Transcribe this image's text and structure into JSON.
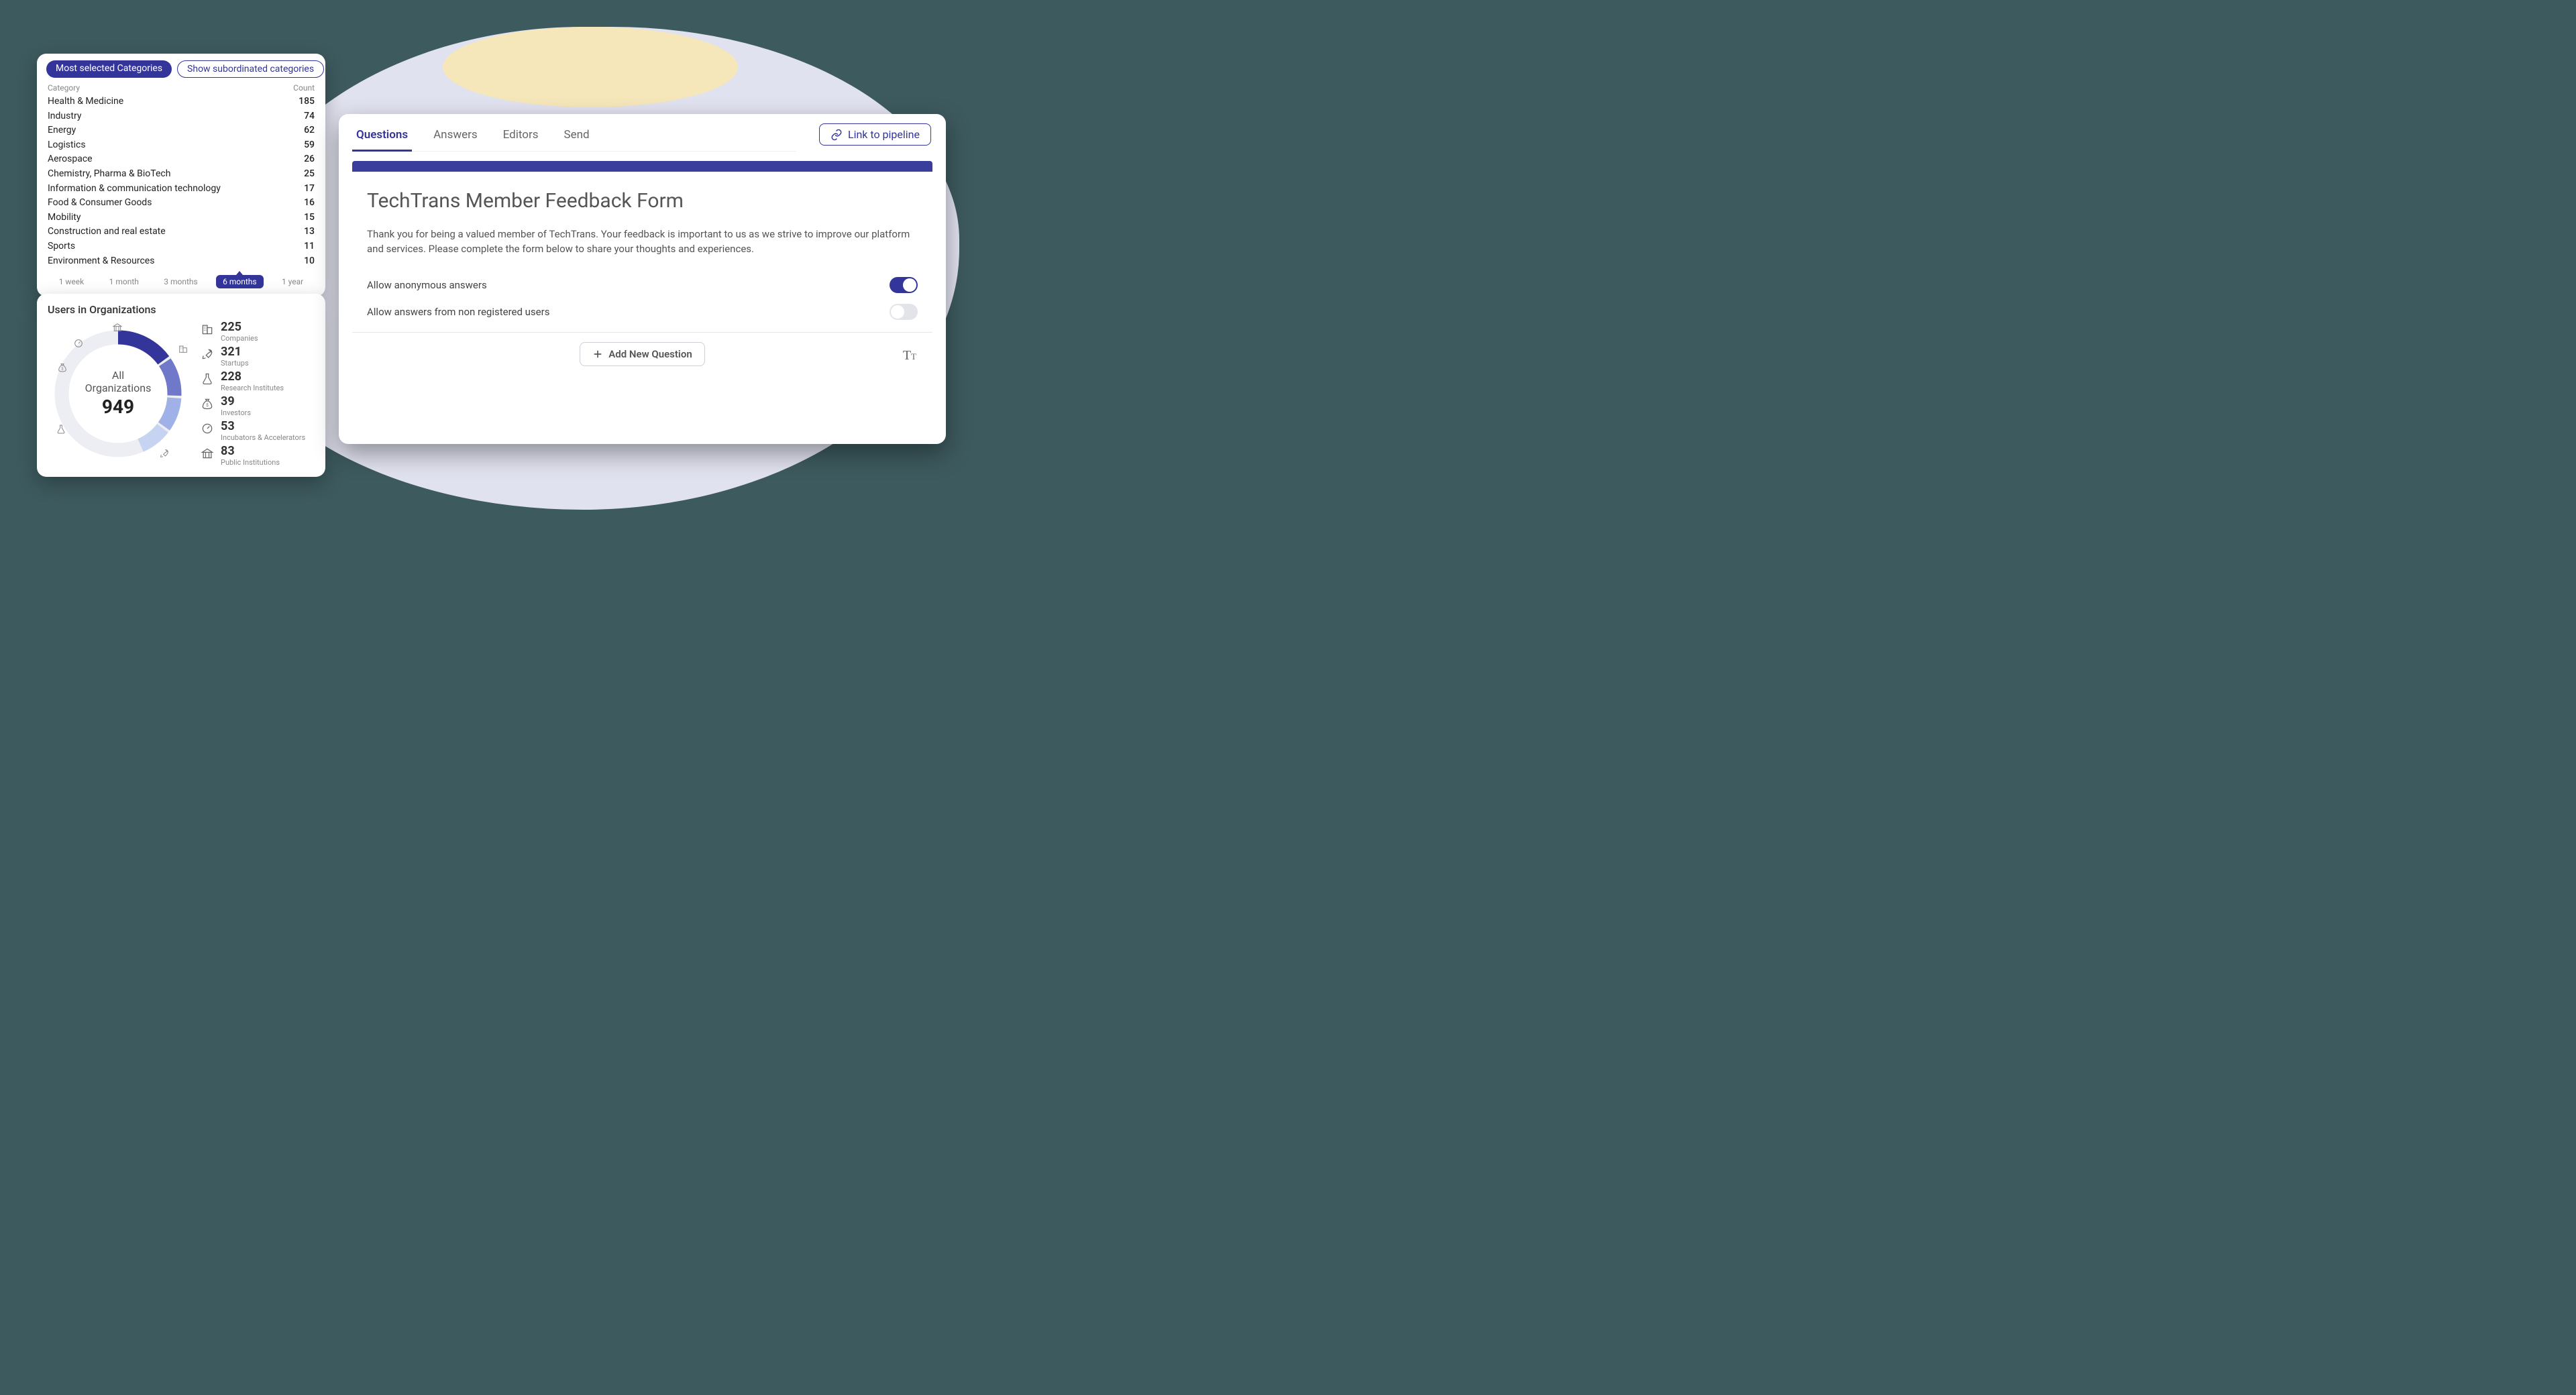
{
  "colors": {
    "primary": "#33359a"
  },
  "categories": {
    "active_pill": "Most selected Categories",
    "outline_pill": "Show subordinated categories",
    "head_left": "Category",
    "head_right": "Count",
    "rows": [
      {
        "label": "Health & Medicine",
        "count": "185"
      },
      {
        "label": "Industry",
        "count": "74"
      },
      {
        "label": "Energy",
        "count": "62"
      },
      {
        "label": "Logistics",
        "count": "59"
      },
      {
        "label": "Aerospace",
        "count": "26"
      },
      {
        "label": "Chemistry, Pharma & BioTech",
        "count": "25"
      },
      {
        "label": "Information & communication technology",
        "count": "17"
      },
      {
        "label": "Food & Consumer Goods",
        "count": "16"
      },
      {
        "label": "Mobility",
        "count": "15"
      },
      {
        "label": "Construction and real estate",
        "count": "13"
      },
      {
        "label": "Sports",
        "count": "11"
      },
      {
        "label": "Environment & Resources",
        "count": "10"
      }
    ],
    "times": [
      {
        "label": "1 week",
        "active": false
      },
      {
        "label": "1 month",
        "active": false
      },
      {
        "label": "3 months",
        "active": false
      },
      {
        "label": "6 months",
        "active": true
      },
      {
        "label": "1 year",
        "active": false
      }
    ]
  },
  "orgs": {
    "title": "Users in Organizations",
    "center_label_a": "All",
    "center_label_b": "Organizations",
    "center_value": "949",
    "stats": [
      {
        "n": "225",
        "t": "Companies",
        "icon": "building-icon"
      },
      {
        "n": "321",
        "t": "Startups",
        "icon": "rocket-icon"
      },
      {
        "n": "228",
        "t": "Research Institutes",
        "icon": "flask-icon"
      },
      {
        "n": "39",
        "t": "Investors",
        "icon": "moneybag-icon"
      },
      {
        "n": "53",
        "t": "Incubators & Accelerators",
        "icon": "gauge-icon"
      },
      {
        "n": "83",
        "t": "Public Institutions",
        "icon": "govt-icon"
      }
    ]
  },
  "form": {
    "tabs": [
      {
        "label": "Questions",
        "active": true
      },
      {
        "label": "Answers",
        "active": false
      },
      {
        "label": "Editors",
        "active": false
      },
      {
        "label": "Send",
        "active": false
      }
    ],
    "link_btn": "Link to pipeline",
    "title": "TechTrans Member Feedback Form",
    "desc": "Thank you for being a valued member of TechTrans. Your feedback is important to us as we strive to improve our platform and services. Please complete the form below to share your thoughts and experiences.",
    "toggles": [
      {
        "label": "Allow anonymous answers",
        "on": true
      },
      {
        "label": "Allow answers from non registered users",
        "on": false
      }
    ],
    "add_btn": "Add New Question"
  }
}
